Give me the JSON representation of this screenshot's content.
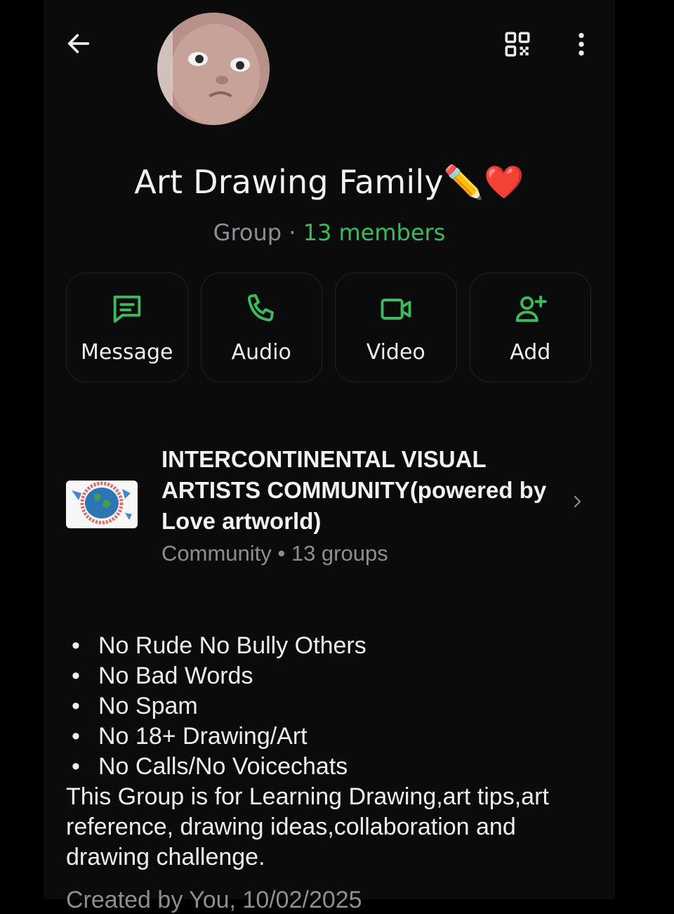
{
  "group": {
    "name": "Art Drawing Family✏️❤️",
    "type_label": "Group",
    "separator": " · ",
    "members_label": "13 members"
  },
  "actions": [
    {
      "label": "Message",
      "icon": "message-icon"
    },
    {
      "label": "Audio",
      "icon": "phone-icon"
    },
    {
      "label": "Video",
      "icon": "video-icon"
    },
    {
      "label": "Add",
      "icon": "add-person-icon"
    }
  ],
  "community": {
    "name": "INTERCONTINENTAL VISUAL ARTISTS COMMUNITY(powered by Love artworld)",
    "meta": "Community • 13 groups"
  },
  "description": {
    "rules": [
      "No Rude No Bully Others",
      "No Bad Words",
      "No Spam",
      "No 18+ Drawing/Art",
      "No Calls/No Voicechats"
    ],
    "text": "This Group is for Learning Drawing,art tips,art reference, drawing ideas,collaboration and drawing challenge."
  },
  "created_line": "Created by You, 10/02/2025",
  "colors": {
    "accent_green": "#3bbb5c",
    "background": "#0b0b0b",
    "text_secondary": "#8a8f93"
  }
}
